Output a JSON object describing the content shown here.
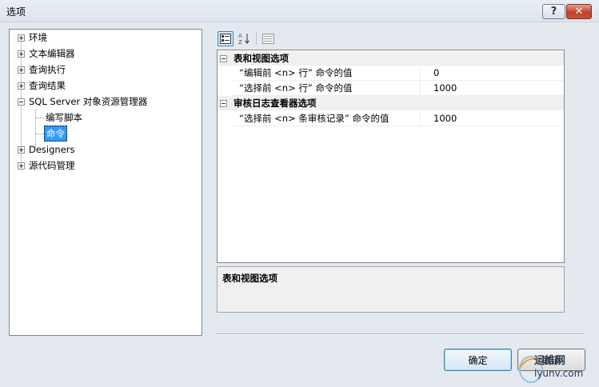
{
  "window": {
    "title": "选项",
    "help_label": "?",
    "close_label": "✕"
  },
  "tree": {
    "items": [
      {
        "label": "环境",
        "expander": "plus"
      },
      {
        "label": "文本编辑器",
        "expander": "plus"
      },
      {
        "label": "查询执行",
        "expander": "plus"
      },
      {
        "label": "查询结果",
        "expander": "plus"
      },
      {
        "label": "SQL Server 对象资源管理器",
        "expander": "minus"
      },
      {
        "label": "编写脚本",
        "expander": "none"
      },
      {
        "label": "命令",
        "expander": "none",
        "selected": true
      },
      {
        "label": "Designers",
        "expander": "plus"
      },
      {
        "label": "源代码管理",
        "expander": "plus"
      }
    ]
  },
  "toolbar": {
    "categorized_icon": "categorized-icon",
    "alphabetical_icon": "alphabetical-sort-icon",
    "property_pages_icon": "property-pages-icon"
  },
  "grid": {
    "categories": [
      {
        "label": "表和视图选项",
        "props": [
          {
            "name": "“编辑前 <n> 行” 命令的值",
            "value": "0"
          },
          {
            "name": "“选择前 <n> 行” 命令的值",
            "value": "1000"
          }
        ]
      },
      {
        "label": "审核日志查看器选项",
        "props": [
          {
            "name": "“选择前 <n> 条审核记录” 命令的值",
            "value": "1000"
          }
        ]
      }
    ]
  },
  "description": {
    "text": "表和视图选项"
  },
  "buttons": {
    "ok_label": "确定",
    "cancel_label": "取消"
  },
  "watermark": {
    "line1": "运维网",
    "line2": "iyunv.com"
  },
  "colors": {
    "selection": "#3399ff",
    "button_border": "#3c7fb1",
    "close_red": "#c0402a"
  }
}
